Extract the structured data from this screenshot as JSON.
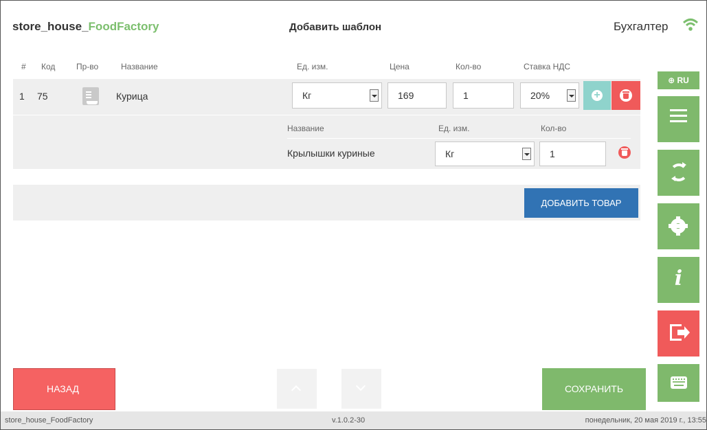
{
  "header": {
    "app_name_prefix": "store_house_",
    "app_name_accent": "FoodFactory",
    "page_title": "Добавить шаблон",
    "user_role": "Бухгалтер",
    "wifi_icon": "wifi-icon"
  },
  "table": {
    "columns": {
      "num": "#",
      "code": "Код",
      "production": "Пр-во",
      "name": "Название",
      "unit": "Ед. изм.",
      "price": "Цена",
      "qty": "Кол-во",
      "vat": "Ставка НДС"
    },
    "row": {
      "num": "1",
      "code": "75",
      "name": "Курица",
      "unit": "Кг",
      "price": "169",
      "qty": "1",
      "vat": "20%"
    },
    "sub_columns": {
      "name": "Название",
      "unit": "Ед. изм.",
      "qty": "Кол-во"
    },
    "sub_row": {
      "name": "Крылышки куриные",
      "unit": "Кг",
      "qty": "1"
    }
  },
  "actions": {
    "add_product": "ДОБАВИТЬ ТОВАР",
    "back": "НАЗАД",
    "save": "СОХРАНИТЬ"
  },
  "sidebar": {
    "lang": "⊕ RU"
  },
  "status_bar": {
    "app": "store_house_FoodFactory",
    "version": "v.1.0.2-30",
    "datetime": "понедельник, 20 мая 2019 г., 13:55"
  },
  "colors": {
    "accent_green": "#7fb96c",
    "danger_red": "#f05a5a",
    "primary_blue": "#3173b4",
    "teal": "#8fd3cc"
  }
}
